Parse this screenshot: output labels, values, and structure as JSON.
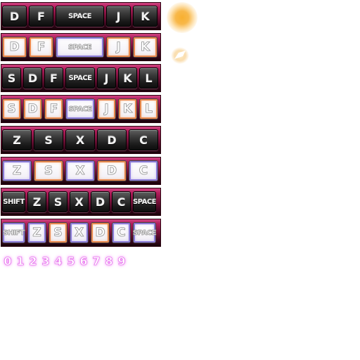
{
  "rows": [
    {
      "keys": [
        {
          "label": "D",
          "w": 36
        },
        {
          "label": "F",
          "w": 36
        },
        {
          "label": "SPACE",
          "w": 70,
          "small": true
        },
        {
          "label": "J",
          "w": 36
        },
        {
          "label": "K",
          "w": 36
        }
      ],
      "style": "up"
    },
    {
      "keys": [
        {
          "label": "D",
          "w": 36,
          "ring": "orange"
        },
        {
          "label": "F",
          "w": 36,
          "ring": "orange"
        },
        {
          "label": "SPACE",
          "w": 70,
          "small": true,
          "ring": "purple"
        },
        {
          "label": "J",
          "w": 36,
          "ring": "orange"
        },
        {
          "label": "K",
          "w": 36,
          "ring": "orange"
        }
      ],
      "style": "pressed"
    },
    {
      "keys": [
        {
          "label": "S",
          "w": 28
        },
        {
          "label": "D",
          "w": 28
        },
        {
          "label": "F",
          "w": 28
        },
        {
          "label": "SPACE",
          "w": 44,
          "small": true
        },
        {
          "label": "J",
          "w": 28
        },
        {
          "label": "K",
          "w": 28
        },
        {
          "label": "L",
          "w": 28
        }
      ],
      "style": "up"
    },
    {
      "keys": [
        {
          "label": "S",
          "w": 28,
          "ring": "orange"
        },
        {
          "label": "D",
          "w": 28,
          "ring": "orange"
        },
        {
          "label": "F",
          "w": 28,
          "ring": "orange"
        },
        {
          "label": "SPACE",
          "w": 44,
          "small": true,
          "ring": "purple"
        },
        {
          "label": "J",
          "w": 28,
          "ring": "orange"
        },
        {
          "label": "K",
          "w": 28,
          "ring": "orange"
        },
        {
          "label": "L",
          "w": 28,
          "ring": "orange"
        }
      ],
      "style": "pressed"
    },
    {
      "keys": [
        {
          "label": "Z",
          "w": 42
        },
        {
          "label": "S",
          "w": 42
        },
        {
          "label": "X",
          "w": 42
        },
        {
          "label": "D",
          "w": 42
        },
        {
          "label": "C",
          "w": 42
        }
      ],
      "style": "up"
    },
    {
      "keys": [
        {
          "label": "Z",
          "w": 42,
          "ring": "purple"
        },
        {
          "label": "S",
          "w": 42,
          "ring": "orange"
        },
        {
          "label": "X",
          "w": 42,
          "ring": "purple"
        },
        {
          "label": "D",
          "w": 42,
          "ring": "orange"
        },
        {
          "label": "C",
          "w": 42,
          "ring": "purple"
        }
      ],
      "style": "pressed"
    },
    {
      "keys": [
        {
          "label": "SHIFT",
          "w": 34,
          "small": true
        },
        {
          "label": "Z",
          "w": 28
        },
        {
          "label": "S",
          "w": 28
        },
        {
          "label": "X",
          "w": 28
        },
        {
          "label": "D",
          "w": 28
        },
        {
          "label": "C",
          "w": 28
        },
        {
          "label": "SPACE",
          "w": 34,
          "small": true
        }
      ],
      "style": "up"
    },
    {
      "keys": [
        {
          "label": "SHIFT",
          "w": 34,
          "small": true,
          "ring": "purple"
        },
        {
          "label": "Z",
          "w": 28,
          "ring": "purple"
        },
        {
          "label": "S",
          "w": 28,
          "ring": "orange"
        },
        {
          "label": "X",
          "w": 28,
          "ring": "purple"
        },
        {
          "label": "D",
          "w": 28,
          "ring": "orange"
        },
        {
          "label": "C",
          "w": 28,
          "ring": "purple"
        },
        {
          "label": "SPACE",
          "w": 34,
          "small": true,
          "ring": "purple"
        }
      ],
      "style": "pressed"
    }
  ],
  "digits": [
    "0",
    "1",
    "2",
    "3",
    "4",
    "5",
    "6",
    "7",
    "8",
    "9"
  ],
  "colors": {
    "strip_top": "#d24a86",
    "strip_bottom": "#120206",
    "ring_orange": "#e9874c",
    "ring_purple": "#8b7ad8",
    "digit_glow": "#f07cf5",
    "burst": "#f8b030"
  },
  "icons": [
    "orange-glow-burst",
    "white-spark-flash"
  ]
}
